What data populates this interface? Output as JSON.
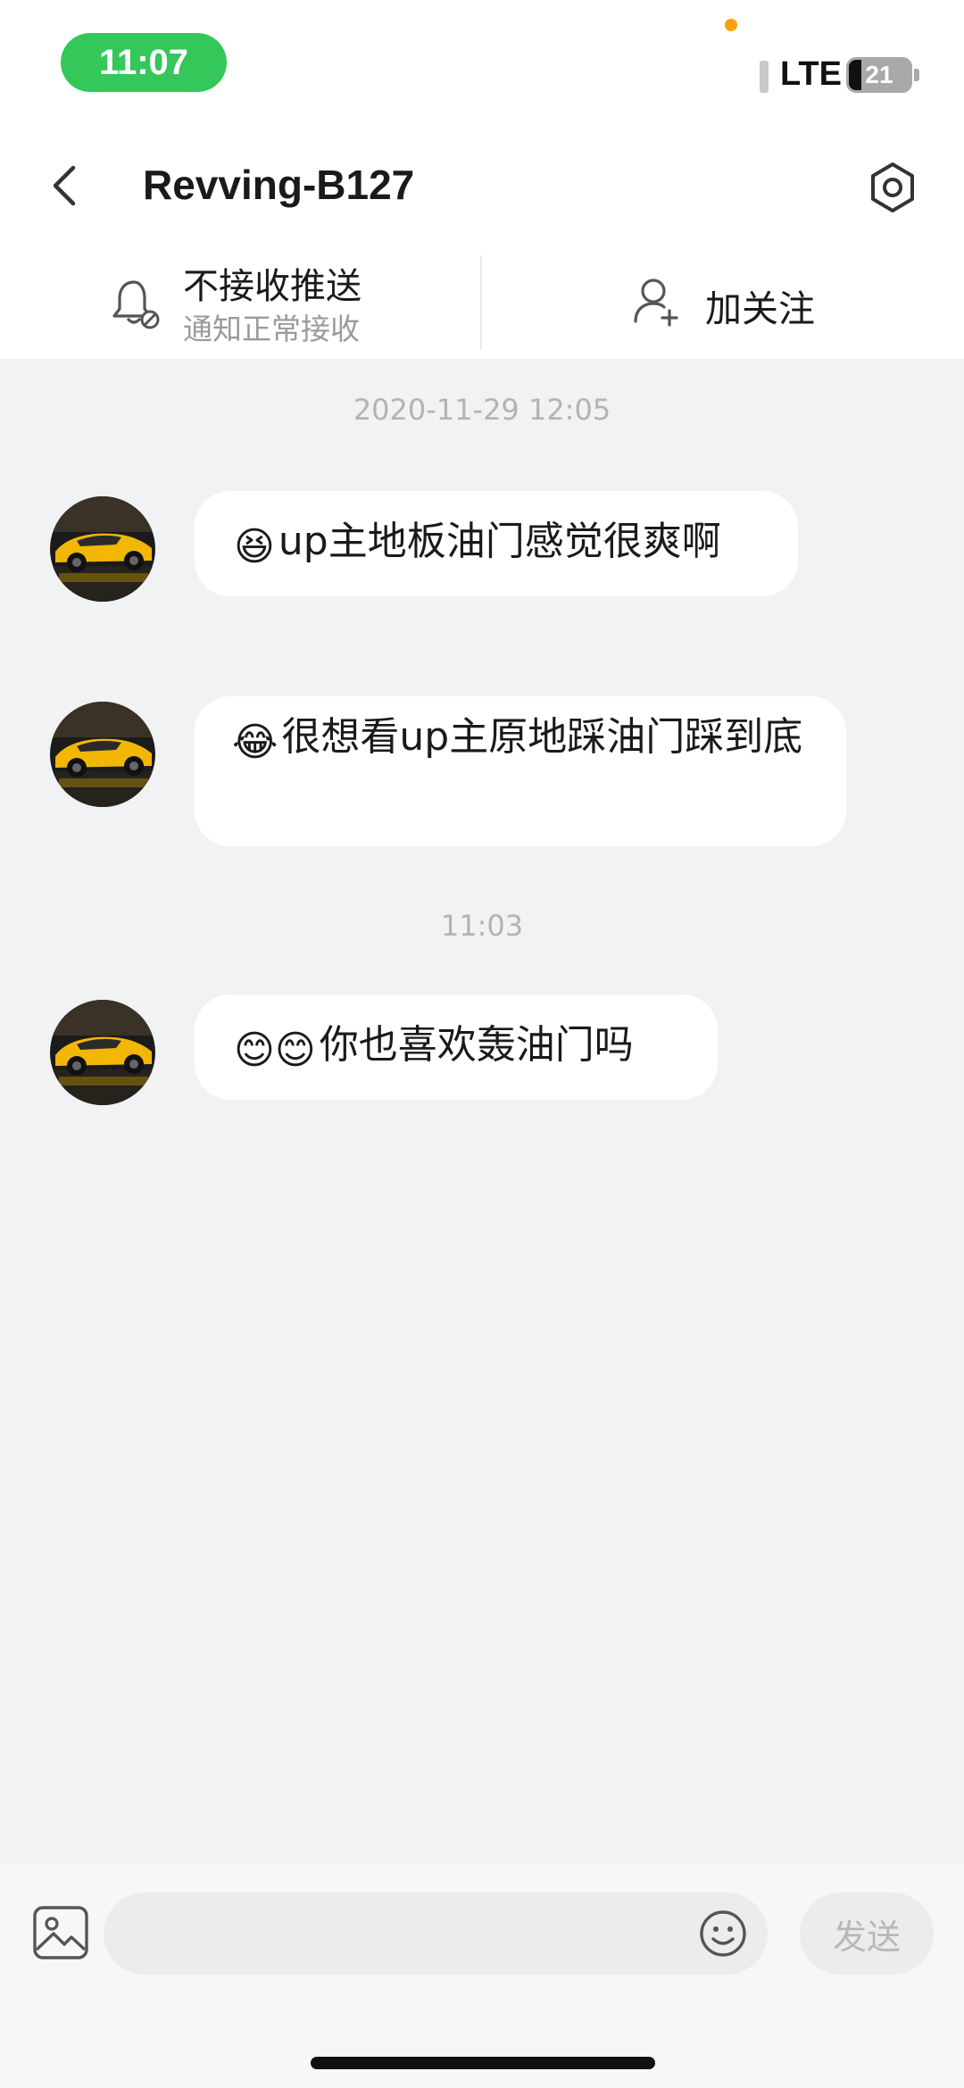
{
  "status_bar": {
    "time": "11:07",
    "network": "LTE",
    "battery": "21",
    "battery_level": 0.21,
    "pill_color": "#34c759",
    "dot_color": "#ff9f0a"
  },
  "header": {
    "title": "Revving-B127",
    "back_icon": "chevron-left-icon",
    "settings_icon": "hexagon-gear-icon"
  },
  "actions": {
    "notify_title": "不接收推送",
    "notify_subtitle": "通知正常接收",
    "follow_label": "加关注"
  },
  "chat": {
    "messages_group1_time": "2020-11-29 12:05",
    "messages_group2_time": "11:03",
    "messages": [
      {
        "emoji": "😆",
        "text": "up主地板油门感觉很爽啊"
      },
      {
        "emoji": "😂",
        "text": "很想看up主原地踩油门踩到底"
      },
      {
        "emoji": "😊😊",
        "text": "你也喜欢轰油门吗"
      }
    ]
  },
  "input_bar": {
    "placeholder": "",
    "send_label": "发送",
    "image_icon": "image-icon",
    "emoji_icon": "smiley-icon"
  },
  "colors": {
    "chat_background": "#f1f2f4",
    "bubble": "#ffffff",
    "muted_text": "#9a9a9a",
    "avatar_car": "#f2b705"
  }
}
